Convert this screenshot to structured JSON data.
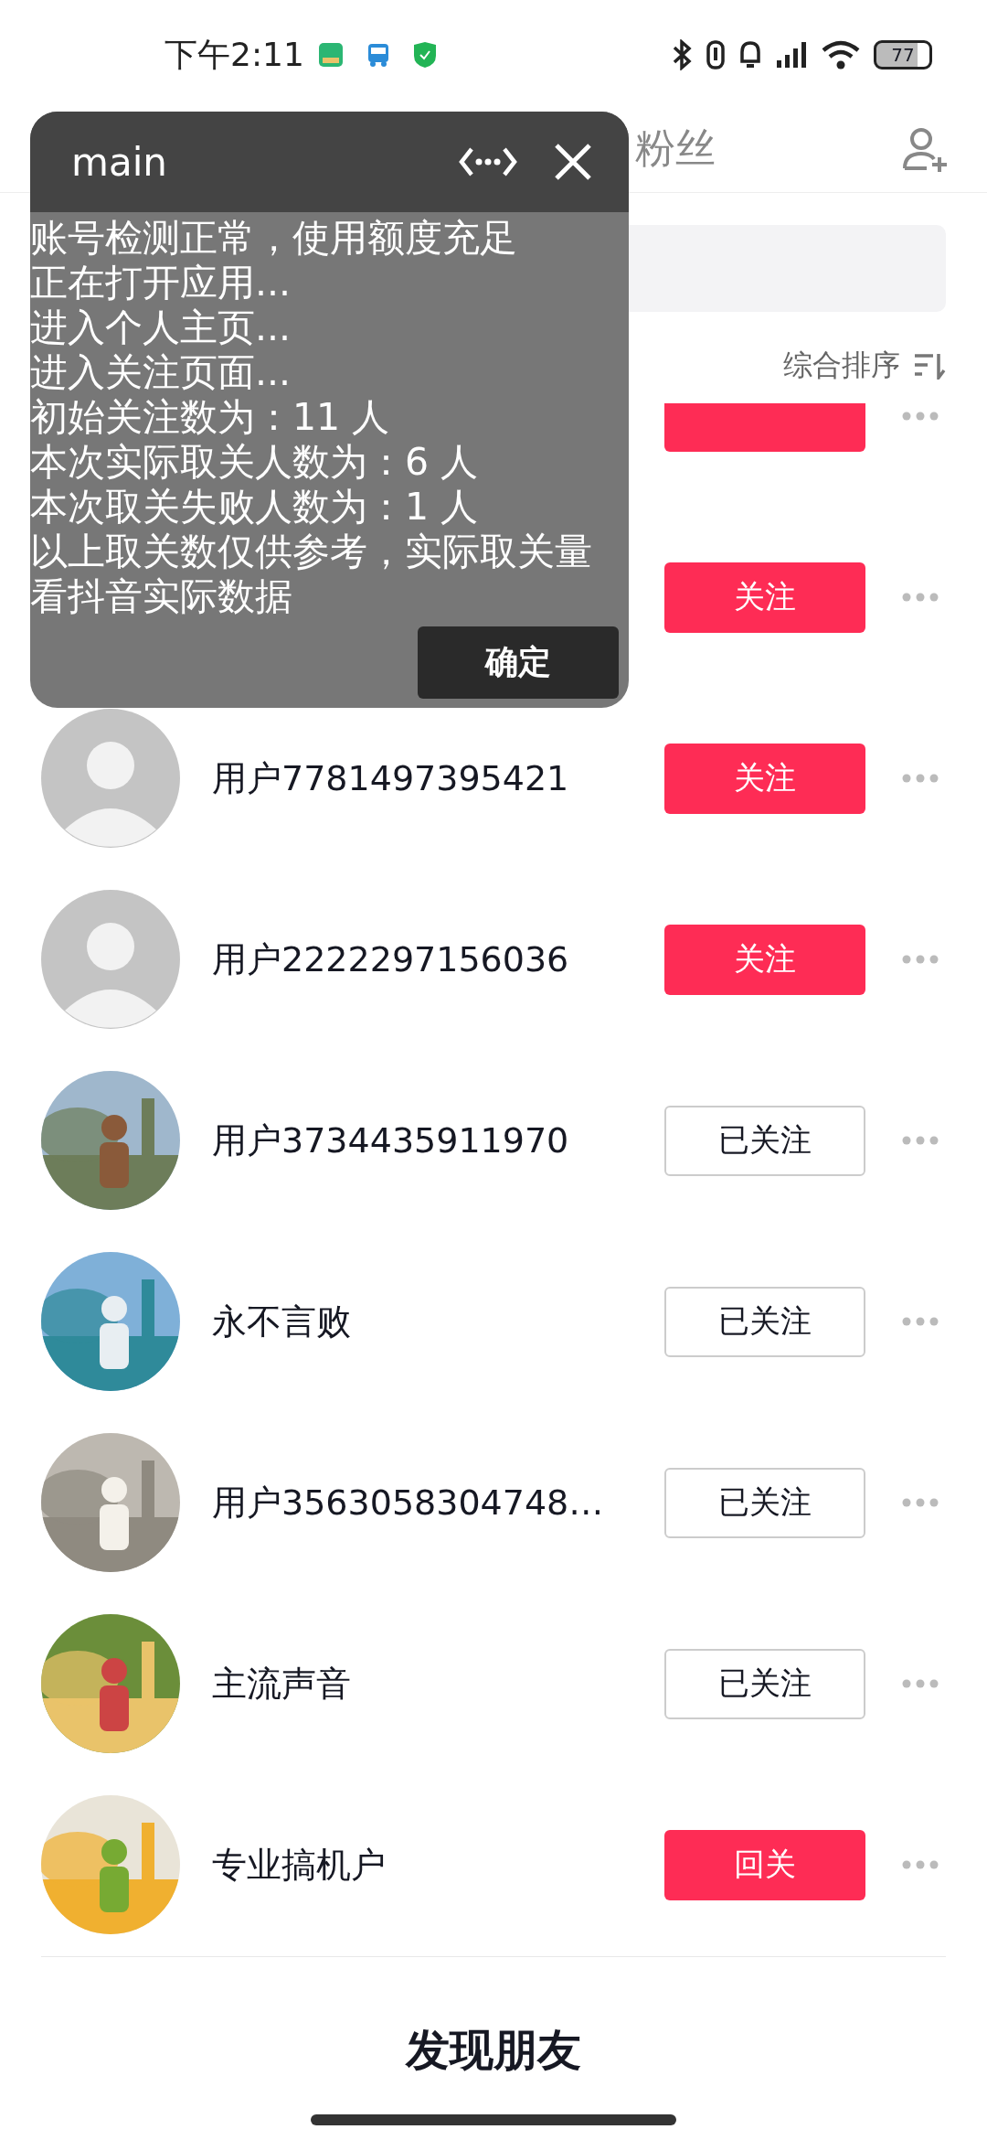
{
  "status_bar": {
    "time": "下午2:11",
    "battery": "77"
  },
  "tabs": [
    {
      "label": "粉丝",
      "selected": false
    }
  ],
  "list_header": {
    "sort": "综合排序"
  },
  "users": [
    {
      "followed": false
    },
    {
      "button": "关注",
      "followed": false
    },
    {
      "name": "用户7781497395421",
      "button": "关注",
      "followed": false,
      "kind": "default"
    },
    {
      "name": "用户2222297156036",
      "button": "关注",
      "followed": false,
      "kind": "default"
    },
    {
      "name": "用户3734435911970",
      "button": "已关注",
      "followed": true
    },
    {
      "name": "永不言败",
      "button": "已关注",
      "followed": true
    },
    {
      "name": "用户3563058304748…",
      "button": "已关注",
      "followed": true
    },
    {
      "name": "主流声音",
      "button": "已关注",
      "followed": true
    },
    {
      "name": "专业搞机户",
      "button": "回关",
      "followed": false
    }
  ],
  "footer": {
    "title": "发现朋友"
  },
  "overlay": {
    "title": "main",
    "lines": [
      "账号检测正常，使用额度充足",
      "正在打开应用...",
      "进入个人主页...",
      "进入关注页面...",
      "初始关注数为：11 人",
      "本次实际取关人数为：6 人",
      "本次取关失败人数为：1 人",
      "以上取关数仅供参考，实际取关量看抖音实际数据"
    ],
    "confirm": "确定"
  }
}
